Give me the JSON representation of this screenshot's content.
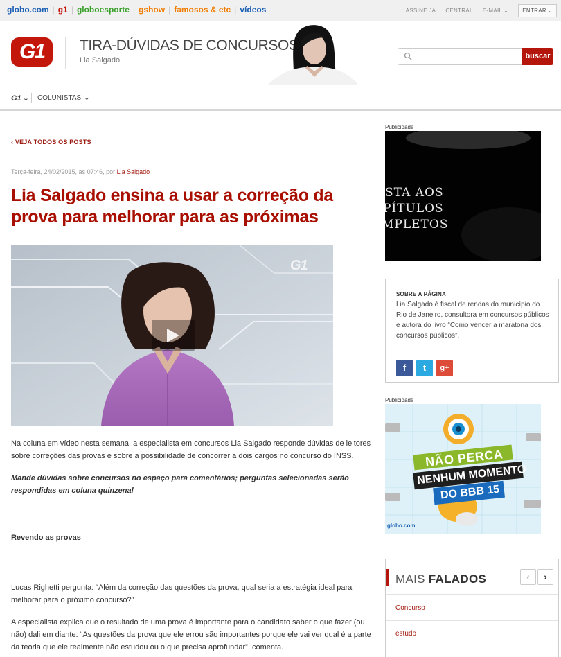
{
  "globo_bar": {
    "brands": [
      {
        "label": "globo.com",
        "color": "#1a5fb4"
      },
      {
        "label": "g1",
        "color": "#c4170c"
      },
      {
        "label": "globoesporte",
        "color": "#39a12a"
      },
      {
        "label": "gshow",
        "color": "#f07d00"
      },
      {
        "label": "famosos & etc",
        "color": "#f07d00"
      },
      {
        "label": "vídeos",
        "color": "#1a5fb4"
      }
    ],
    "assine": "ASSINE JÁ",
    "central": "CENTRAL",
    "email": "E-MAIL",
    "entrar": "ENTRAR"
  },
  "header": {
    "logo": "G1",
    "title": "TIRA-DÚVIDAS DE CONCURSOS",
    "subtitle": "Lia Salgado",
    "search_placeholder": "",
    "search_button": "buscar"
  },
  "nav": {
    "home": "G1",
    "colunistas": "COLUNISTAS"
  },
  "article": {
    "back_link": "VEJA TODOS OS POSTS",
    "meta_date": "Terça-feira, 24/02/2015, às 07:46, por",
    "meta_author": "Lia Salgado",
    "title": "Lia Salgado ensina a usar a correção da prova para melhorar para as próximas",
    "video_watermark": "G1",
    "p1": "Na coluna em vídeo nesta semana, a especialista em concursos Lia Salgado responde dúvidas de leitores sobre correções das provas e sobre a possibilidade de concorrer a dois cargos no concurso do INSS.",
    "p2": "Mande dúvidas sobre concursos no espaço para comentários; perguntas selecionadas serão respondidas em coluna quinzenal",
    "section_heading": "Revendo as provas",
    "p3": "Lucas Righetti pergunta: “Além da correção das questões da prova, qual seria a estratégia ideal para melhorar para o próximo concurso?”",
    "p4": "A especialista explica que o resultado de uma prova é importante para o candidato saber o que fazer (ou não) dali em diante. “As questões da prova que ele errou são importantes porque ele vai ver qual é a parte da teoria que ele realmente não estudou ou o que precisa aprofundar”, comenta."
  },
  "sidebar": {
    "ad1_label": "Publicidade",
    "ad1_lines": [
      "STA AOS",
      "PÍTULOS",
      "MPLETOS"
    ],
    "about_heading": "SOBRE A PÁGINA",
    "about_text": "Lia Salgado é fiscal de rendas do município do Rio de Janeiro, consultora em concursos públicos e autora do livro “Como vencer a maratona dos concursos públicos”.",
    "social": {
      "facebook": "f",
      "twitter": "t",
      "gplus": "g+"
    },
    "ad2_label": "Publicidade",
    "ad2_lines": [
      "NÃO PERCA",
      "NENHUM MOMENTO",
      "DO BBB 15"
    ],
    "ad2_brand": "globo.com",
    "mais_prefix": "MAIS",
    "mais_bold": "FALADOS",
    "mais_items": [
      "Concurso",
      "estudo"
    ],
    "prev": "‹",
    "next": "›"
  }
}
